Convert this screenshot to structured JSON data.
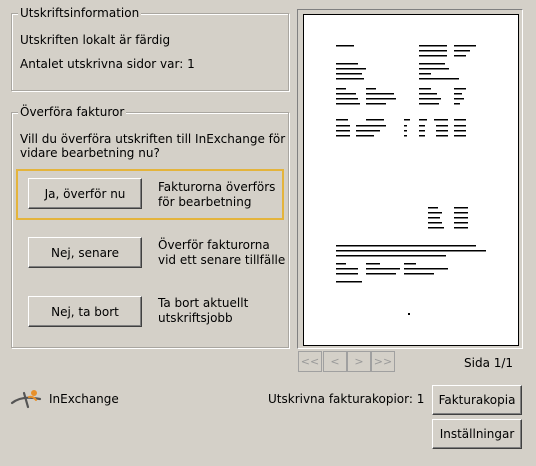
{
  "print_info": {
    "legend": "Utskriftsinformation",
    "status": "Utskriften lokalt är färdig",
    "pages_line": "Antalet utskrivna sidor var: 1"
  },
  "transfer": {
    "legend": "Överföra fakturor",
    "question_line1": "Vill du överföra utskriften till InExchange för",
    "question_line2": "vidare bearbetning nu?",
    "options": [
      {
        "button": "Ja, överför nu",
        "desc1": "Fakturorna överförs",
        "desc2": "för bearbetning"
      },
      {
        "button": "Nej, senare",
        "desc1": "Överför fakturorna",
        "desc2": "vid ett senare tillfälle"
      },
      {
        "button": "Nej, ta bort",
        "desc1": "Ta bort aktuellt",
        "desc2": "utskriftsjobb"
      }
    ]
  },
  "preview": {
    "nav": {
      "first": "<<",
      "prev": "<",
      "next": ">",
      "last": ">>"
    },
    "page_label": "Sida 1/1"
  },
  "footer": {
    "logo_text": "InExchange",
    "copies_label": "Utskrivna fakturakopior: 1",
    "invoice_copy_button": "Fakturakopia",
    "settings_button": "Inställningar"
  },
  "icons": {
    "logo": "inexchange-logo-icon"
  },
  "colors": {
    "highlight": "#e4b43c",
    "background": "#d4d0c8"
  }
}
